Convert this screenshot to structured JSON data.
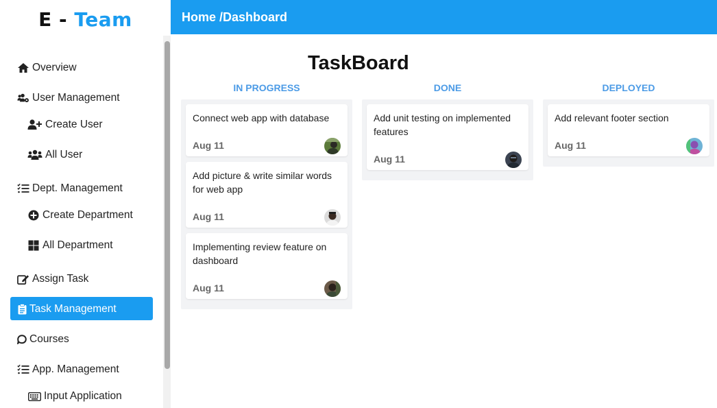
{
  "brand": {
    "part1": "E - ",
    "part2": "Team"
  },
  "header": {
    "breadcrumb": "Home /Dashboard"
  },
  "sidebar": {
    "items": [
      {
        "label": "Overview",
        "icon": "home-icon"
      },
      {
        "label": "User Management",
        "icon": "users-cog-icon"
      },
      {
        "label": "Create User",
        "icon": "user-plus-icon"
      },
      {
        "label": "All User",
        "icon": "users-icon"
      },
      {
        "label": "Dept. Management",
        "icon": "list-check-icon"
      },
      {
        "label": "Create Department",
        "icon": "plus-circle-icon"
      },
      {
        "label": "All Department",
        "icon": "grid-icon"
      },
      {
        "label": "Assign Task",
        "icon": "edit-icon"
      },
      {
        "label": "Task Management",
        "icon": "clipboard-icon"
      },
      {
        "label": "Courses",
        "icon": "chat-bubble-icon"
      },
      {
        "label": "App. Management",
        "icon": "list-check-icon"
      },
      {
        "label": "Input Application",
        "icon": "keyboard-icon"
      }
    ],
    "active": "Task Management"
  },
  "board": {
    "title": "TaskBoard",
    "columns": [
      {
        "title": "IN PROGRESS",
        "cards": [
          {
            "title": "Connect web app with database",
            "date": "Aug 11"
          },
          {
            "title": "Add picture & write similar words for web app",
            "date": "Aug 11"
          },
          {
            "title": "Implementing review feature on dashboard",
            "date": "Aug 11"
          }
        ]
      },
      {
        "title": "DONE",
        "cards": [
          {
            "title": "Add unit testing on implemented features",
            "date": "Aug 11"
          }
        ]
      },
      {
        "title": "DEPLOYED",
        "cards": [
          {
            "title": "Add relevant footer section",
            "date": "Aug 11"
          }
        ]
      }
    ]
  },
  "colors": {
    "accent": "#1a9cf0",
    "column_title": "#4c9be6"
  }
}
